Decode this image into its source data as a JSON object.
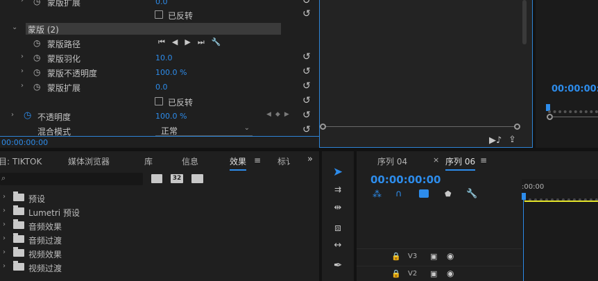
{
  "effect_controls": {
    "top_partial": {
      "label": "蒙版扩展",
      "value": "0.0",
      "invert_label": "已反转"
    },
    "mask_header": "蒙版 (2)",
    "mask_path": "蒙版路径",
    "feather": {
      "label": "蒙版羽化",
      "value": "10.0"
    },
    "opacity_mask": {
      "label": "蒙版不透明度",
      "value": "100.0 %"
    },
    "expansion": {
      "label": "蒙版扩展",
      "value": "0.0"
    },
    "inverted_label": "已反转",
    "opacity": {
      "label": "不透明度",
      "value": "100.0 %"
    },
    "blend_mode": {
      "label": "混合模式",
      "value": "正常"
    },
    "timecode": "00:00:00:00"
  },
  "program": {
    "timecode": "00:00:00:0"
  },
  "project_panel": {
    "tabs": [
      "目: TIKTOK",
      "媒体浏览器",
      "库",
      "信息",
      "效果",
      "标讠"
    ],
    "active_tab": "效果",
    "search_placeholder": "",
    "filter_badge": "32",
    "folders": [
      "预设",
      "Lumetri 预设",
      "音频效果",
      "音频过渡",
      "视频效果",
      "视频过渡"
    ]
  },
  "timeline": {
    "tab_inactive": "序列 04",
    "tab_active": "序列 06",
    "timecode": "00:00:00:00",
    "ruler_label": ":00:00",
    "tracks": [
      "V3",
      "V2"
    ]
  },
  "colors": {
    "accent": "#2d8ceb",
    "panel": "#1f1f1f",
    "playhead": "#2d8ceb",
    "work_area": "#e6e62a"
  }
}
